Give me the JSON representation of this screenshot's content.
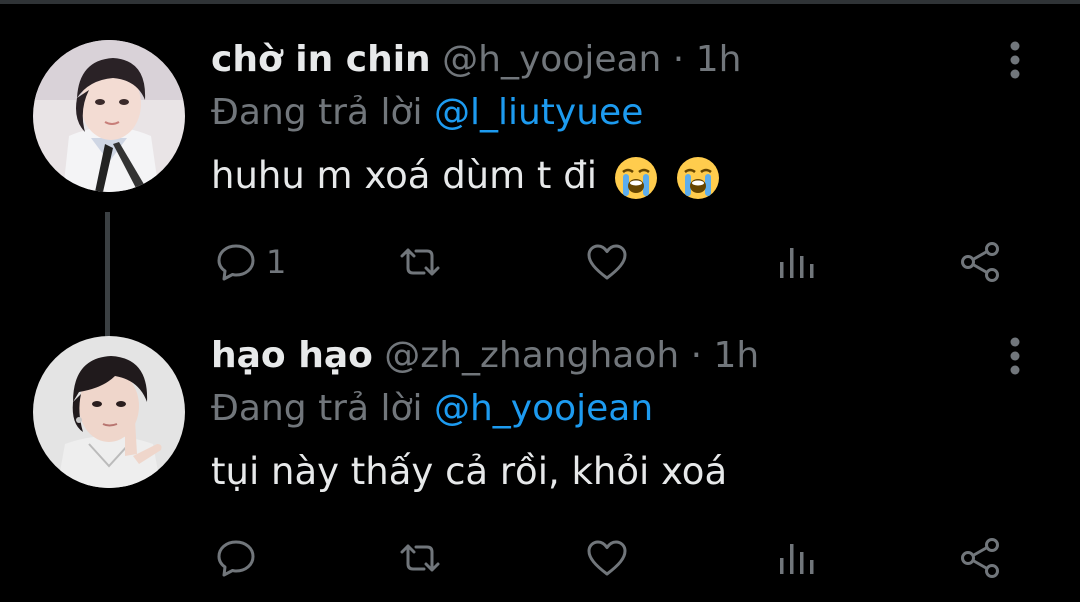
{
  "tweets": [
    {
      "name": "chờ in chin",
      "handle": "@h_yoojean",
      "separator": "·",
      "time": "1h",
      "reply_prefix": "Đang trả lời",
      "reply_to": "@l_liutyuee",
      "text": "huhu m xoá dùm t đi",
      "emojis": [
        "loudly-crying-face",
        "loudly-crying-face"
      ],
      "reply_count": "1"
    },
    {
      "name": "hạo hạo",
      "handle": "@zh_zhanghaoh",
      "separator": "·",
      "time": "1h",
      "reply_prefix": "Đang trả lời",
      "reply_to": "@h_yoojean",
      "text": "tụi này thấy cả rồi, khỏi xoá",
      "reply_count": ""
    }
  ],
  "colors": {
    "background": "#000000",
    "text": "#e7e9ea",
    "muted": "#71767b",
    "mention": "#1d9bf0"
  }
}
